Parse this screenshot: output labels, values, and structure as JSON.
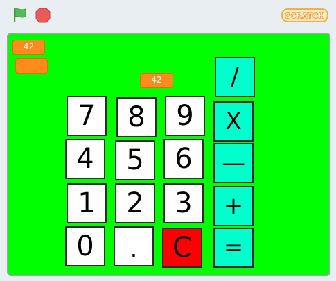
{
  "toolbar": {
    "green_flag_icon": "green-flag-icon",
    "stop_icon": "stop-icon",
    "logo_text": "SCRATCH"
  },
  "stage": {
    "background": "#00ff00",
    "variables": [
      {
        "value": "42",
        "has_value": true
      },
      {
        "value": "",
        "has_value": false
      },
      {
        "value": "42",
        "has_value": true
      }
    ],
    "keys": {
      "seven": "7",
      "eight": "8",
      "nine": "9",
      "four": "4",
      "five": "5",
      "six": "6",
      "one": "1",
      "two": "2",
      "three": "3",
      "zero": "0",
      "dot": ".",
      "clear": "C",
      "divide": "/",
      "multiply": "X",
      "minus": "—",
      "plus": "+",
      "equals": "="
    },
    "colors": {
      "digit_key": "#ffffff",
      "operator_key": "#00ffcc",
      "clear_key": "#ff0000",
      "variable": "#ff8c1a"
    }
  }
}
